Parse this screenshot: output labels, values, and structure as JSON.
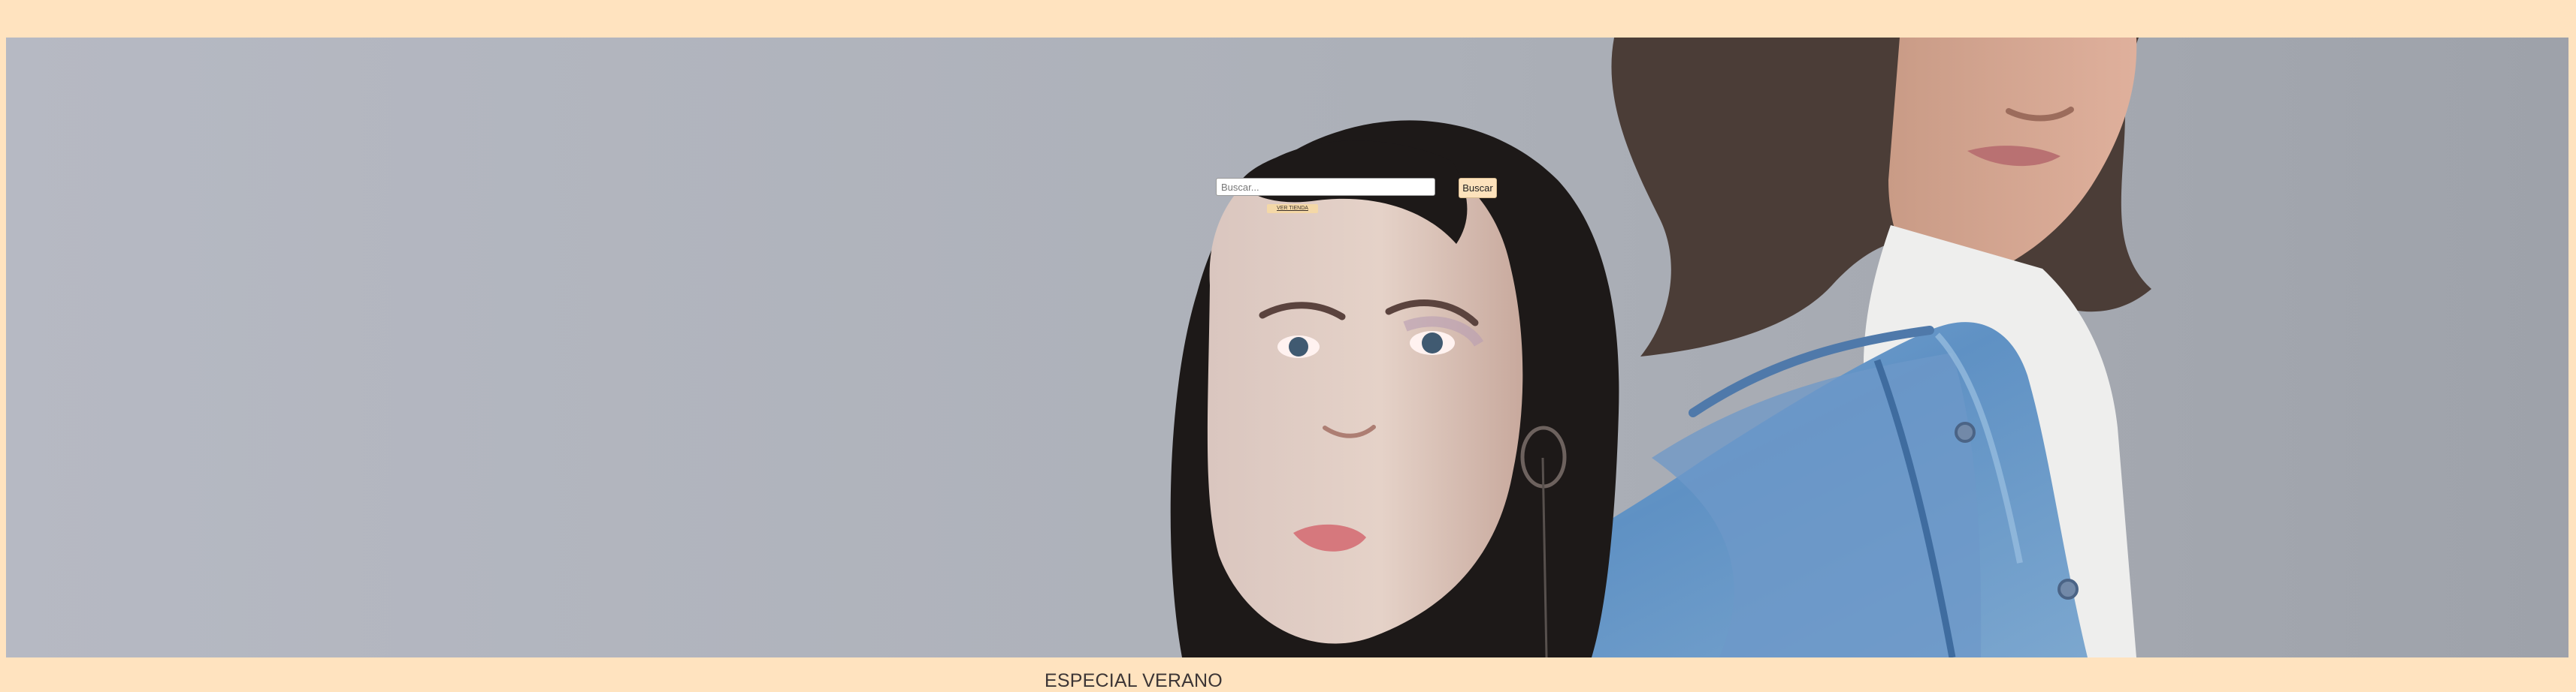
{
  "page": {
    "background_color": "#ffe3bf"
  },
  "hero": {
    "image_label": "portrait of two people, woman in denim jacket and man with long hair",
    "accent_color": "#6d95c2"
  },
  "search": {
    "placeholder": "Buscar...",
    "value": "",
    "button_label": "Buscar"
  },
  "promo": {
    "small_link_label": "VER TIENDA",
    "section_title": "ESPECIAL VERANO"
  }
}
